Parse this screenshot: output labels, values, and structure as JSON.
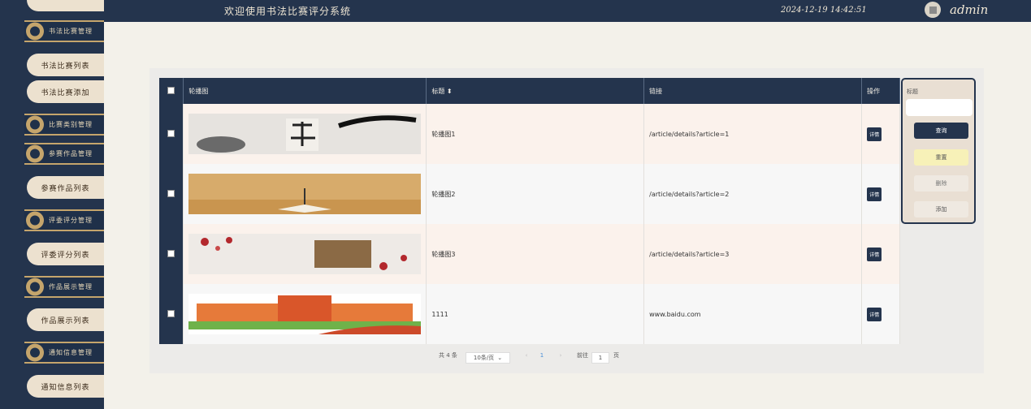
{
  "header": {
    "title": "欢迎使用书法比赛评分系统",
    "datetime": "2024-12-19 14:42:51",
    "username": "admin"
  },
  "sidebar": {
    "items": [
      {
        "type": "menu",
        "label": "书法比赛管理"
      },
      {
        "type": "sub",
        "label": "书法比赛列表"
      },
      {
        "type": "sub",
        "label": "书法比赛添加"
      },
      {
        "type": "menu",
        "label": "比赛类别管理"
      },
      {
        "type": "menu",
        "label": "参赛作品管理"
      },
      {
        "type": "sub",
        "label": "参赛作品列表"
      },
      {
        "type": "menu",
        "label": "评委评分管理"
      },
      {
        "type": "sub",
        "label": "评委评分列表"
      },
      {
        "type": "menu",
        "label": "作品展示管理"
      },
      {
        "type": "sub",
        "label": "作品展示列表"
      },
      {
        "type": "menu",
        "label": "通知信息管理"
      },
      {
        "type": "sub",
        "label": "通知信息列表"
      }
    ]
  },
  "table": {
    "headers": {
      "image": "轮播图",
      "title": "标题 ⬍",
      "link": "链接",
      "action": "操作"
    },
    "rows": [
      {
        "title": "轮播图1",
        "link": "/article/details?article=1",
        "action": "详情",
        "image": "calligraphy-brush-banner"
      },
      {
        "title": "轮播图2",
        "link": "/article/details?article=2",
        "action": "详情",
        "image": "book-on-wood-banner"
      },
      {
        "title": "轮播图3",
        "link": "/article/details?article=3",
        "action": "详情",
        "image": "plum-blossom-scroll-banner"
      },
      {
        "title": "1111",
        "link": "www.baidu.com",
        "action": "详情",
        "image": "school-building-banner"
      }
    ]
  },
  "search": {
    "label": "标题",
    "query_label": "查询",
    "reset_label": "重置",
    "delete_label": "删除",
    "add_label": "添加"
  },
  "pagination": {
    "total": "共 4 条",
    "page_size": "10条/页",
    "current_page": "1",
    "goto_prefix": "前往",
    "goto_value": "1",
    "goto_suffix": "页"
  },
  "colors": {
    "navy": "#24344d",
    "cream": "#ece1cf",
    "gold": "#c5a56c"
  }
}
